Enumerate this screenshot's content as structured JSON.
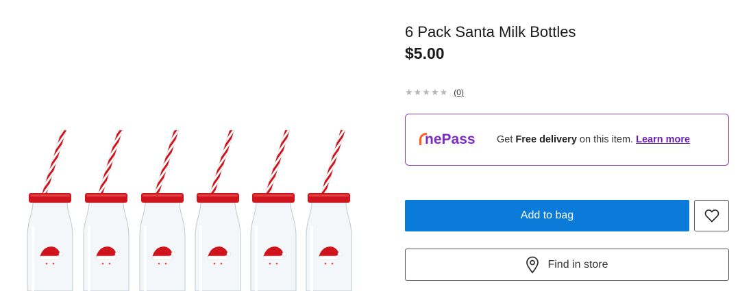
{
  "product": {
    "title": "6 Pack Santa Milk Bottles",
    "price": "$5.00",
    "rating": {
      "stars": "★★★★★",
      "review_count": "(0)"
    }
  },
  "onepass": {
    "logo": "nePass",
    "text_prefix": "Get ",
    "text_bold": "Free delivery",
    "text_suffix": " on this item. ",
    "link": "Learn more"
  },
  "actions": {
    "add_to_bag": "Add to bag",
    "find_in_store": "Find in store"
  },
  "icons": {
    "wishlist": "heart-icon",
    "store": "location-pin-icon"
  },
  "colors": {
    "primary_button": "#0a7bd8",
    "onepass_purple": "#7b2cc4",
    "onepass_accent": "#ff5a1f",
    "lid_red": "#d0141d"
  }
}
